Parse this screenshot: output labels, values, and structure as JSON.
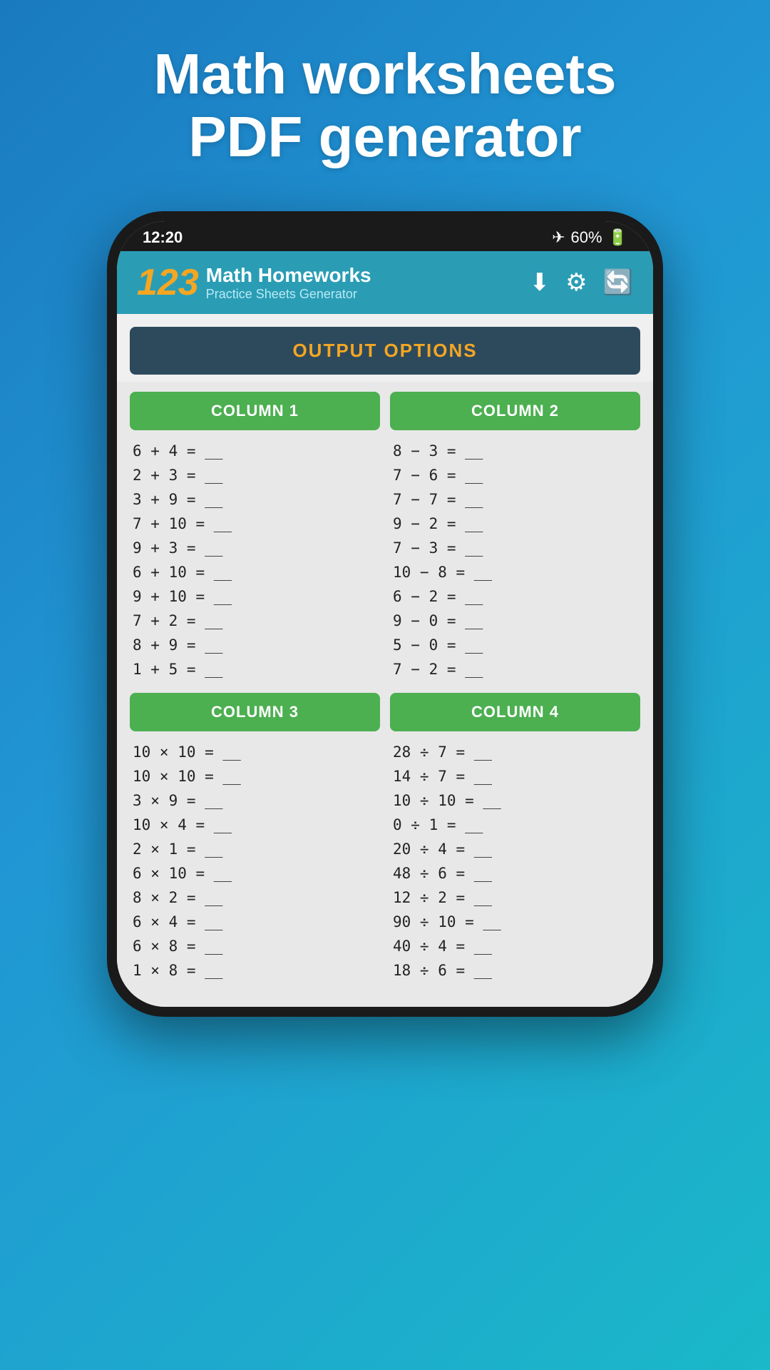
{
  "page": {
    "title_line1": "Math worksheets",
    "title_line2": "PDF generator"
  },
  "status_bar": {
    "time": "12:20",
    "airplane": "✈",
    "battery": "60%"
  },
  "app_header": {
    "logo_number": "123",
    "title": "Math Homeworks",
    "subtitle": "Practice Sheets Generator",
    "icons": [
      "⬇",
      "⚙",
      "🔄"
    ]
  },
  "output_options": {
    "label": "OUTPUT OPTIONS"
  },
  "column1": {
    "header": "COLUMN 1",
    "problems": [
      "6 + 4 = __",
      "2 + 3 = __",
      "3 + 9 = __",
      "7 + 10 = __",
      "9 + 3 = __",
      "6 + 10 = __",
      "9 + 10 = __",
      "7 + 2 = __",
      "8 + 9 = __",
      "1 + 5 = __"
    ]
  },
  "column2": {
    "header": "COLUMN 2",
    "problems": [
      "8 − 3 = __",
      "7 − 6 = __",
      "7 − 7 = __",
      "9 − 2 = __",
      "7 − 3 = __",
      "10 − 8 = __",
      "6 − 2 = __",
      "9 − 0 = __",
      "5 − 0 = __",
      "7 − 2 = __"
    ]
  },
  "column3": {
    "header": "COLUMN 3",
    "problems": [
      "10 × 10 = __",
      "10 × 10 = __",
      "3 × 9 = __",
      "10 × 4 = __",
      "2 × 1 = __",
      "6 × 10 = __",
      "8 × 2 = __",
      "6 × 4 = __",
      "6 × 8 = __",
      "1 × 8 = __"
    ]
  },
  "column4": {
    "header": "COLUMN 4",
    "problems": [
      "28 ÷ 7 = __",
      "14 ÷ 7 = __",
      "10 ÷ 10 = __",
      "0 ÷ 1 = __",
      "20 ÷ 4 = __",
      "48 ÷ 6 = __",
      "12 ÷ 2 = __",
      "90 ÷ 10 = __",
      "40 ÷ 4 = __",
      "18 ÷ 6 = __"
    ]
  }
}
